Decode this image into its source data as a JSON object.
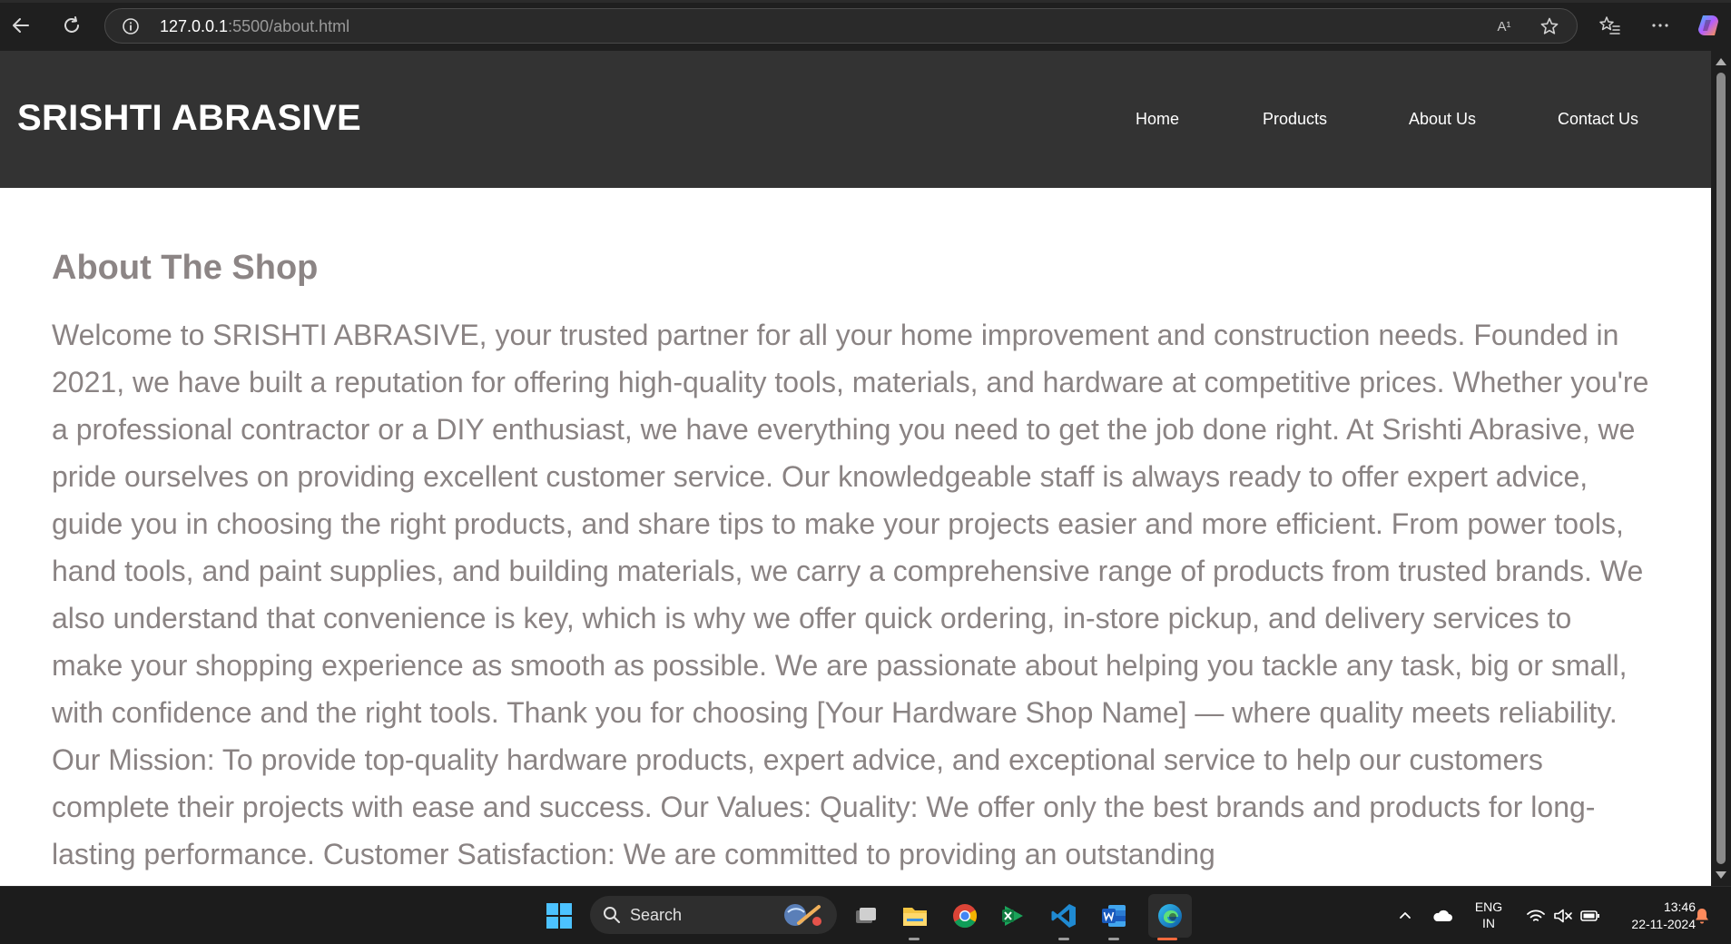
{
  "browser": {
    "url_host": "127.0.0.1",
    "url_path": ":5500/about.html",
    "read_aloud_label": "A¹"
  },
  "site": {
    "logo": "SRISHTI ABRASIVE",
    "nav": {
      "home": "Home",
      "products": "Products",
      "about": "About Us",
      "contact": "Contact Us"
    }
  },
  "page": {
    "title": "About The Shop",
    "body": "Welcome to SRISHTI ABRASIVE, your trusted partner for all your home improvement and construction needs. Founded in 2021, we have built a reputation for offering high-quality tools, materials, and hardware at competitive prices. Whether you're a professional contractor or a DIY enthusiast, we have everything you need to get the job done right. At Srishti Abrasive, we pride ourselves on providing excellent customer service. Our knowledgeable staff is always ready to offer expert advice, guide you in choosing the right products, and share tips to make your projects easier and more efficient. From power tools, hand tools, and paint supplies, and building materials, we carry a comprehensive range of products from trusted brands. We also understand that convenience is key, which is why we offer quick ordering, in-store pickup, and delivery services to make your shopping experience as smooth as possible. We are passionate about helping you tackle any task, big or small, with confidence and the right tools. Thank you for choosing [Your Hardware Shop Name] — where quality meets reliability. Our Mission: To provide top-quality hardware products, expert advice, and exceptional service to help our customers complete their projects with ease and success. Our Values: Quality: We offer only the best brands and products for long-lasting performance. Customer Satisfaction: We are committed to providing an outstanding"
  },
  "taskbar": {
    "search_label": "Search",
    "lang_top": "ENG",
    "lang_bottom": "IN",
    "time": "13:46",
    "date": "22-11-2024"
  },
  "colors": {
    "header_bg": "#333333",
    "text_gray": "#8a8383",
    "browser_bg": "#1f1f1f"
  }
}
